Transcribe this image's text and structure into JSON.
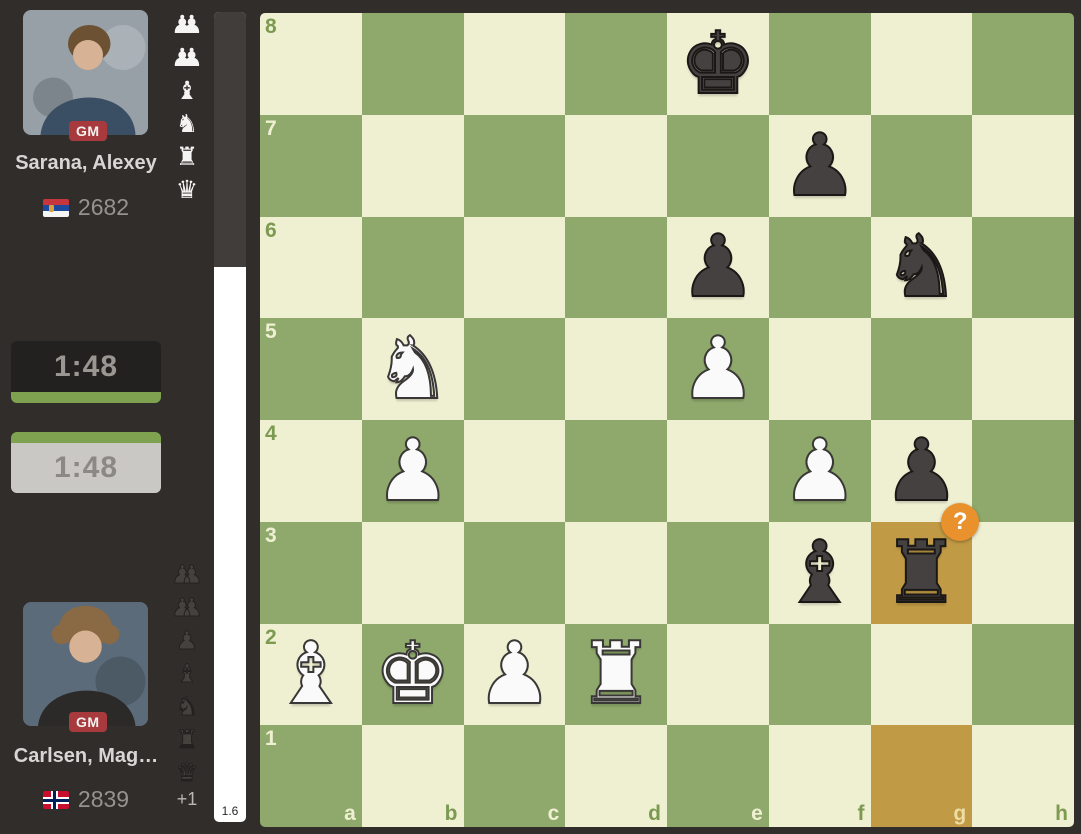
{
  "players": {
    "top": {
      "name": "Sarana, Alexey",
      "title": "GM",
      "rating": "2682",
      "country": "Serbia",
      "clock": "1:48",
      "captured_pieces": [
        "pawn-pair",
        "pawn-pair",
        "bishop",
        "knight",
        "rook",
        "queen"
      ]
    },
    "bottom": {
      "name": "Carlsen, Mag…",
      "title": "GM",
      "rating": "2839",
      "country": "Norway",
      "clock": "1:48",
      "material_advantage": "+1",
      "captured_pieces": [
        "pawn-pair",
        "pawn-pair",
        "pawn",
        "bishop",
        "knight",
        "rook",
        "queen"
      ]
    }
  },
  "eval_bar": {
    "value": "1.6",
    "white_percent": 68.5,
    "black_color": "#403d3a"
  },
  "board": {
    "orientation": "white-bottom",
    "files": [
      "a",
      "b",
      "c",
      "d",
      "e",
      "f",
      "g",
      "h"
    ],
    "ranks": [
      "1",
      "2",
      "3",
      "4",
      "5",
      "6",
      "7",
      "8"
    ],
    "light_color": "#eff0d2",
    "dark_color": "#8ea96b",
    "highlight_color": "#c09a44",
    "light_label_color": "#7c9a51",
    "dark_label_color": "#eff0d2",
    "highlight_label_color": "#eddca4",
    "pieces": [
      {
        "square": "e8",
        "color": "black",
        "type": "king"
      },
      {
        "square": "f7",
        "color": "black",
        "type": "pawn"
      },
      {
        "square": "e6",
        "color": "black",
        "type": "pawn"
      },
      {
        "square": "g6",
        "color": "black",
        "type": "knight"
      },
      {
        "square": "b5",
        "color": "white",
        "type": "knight"
      },
      {
        "square": "e5",
        "color": "white",
        "type": "pawn"
      },
      {
        "square": "b4",
        "color": "white",
        "type": "pawn"
      },
      {
        "square": "f4",
        "color": "white",
        "type": "pawn"
      },
      {
        "square": "g4",
        "color": "black",
        "type": "pawn"
      },
      {
        "square": "f3",
        "color": "black",
        "type": "bishop"
      },
      {
        "square": "g3",
        "color": "black",
        "type": "rook"
      },
      {
        "square": "a2",
        "color": "white",
        "type": "bishop"
      },
      {
        "square": "b2",
        "color": "white",
        "type": "king"
      },
      {
        "square": "c2",
        "color": "white",
        "type": "pawn"
      },
      {
        "square": "d2",
        "color": "white",
        "type": "rook"
      }
    ],
    "highlighted_squares": [
      "g1",
      "g3"
    ],
    "move_badge": {
      "square": "g3",
      "symbol": "?",
      "color": "#e8912d"
    }
  }
}
